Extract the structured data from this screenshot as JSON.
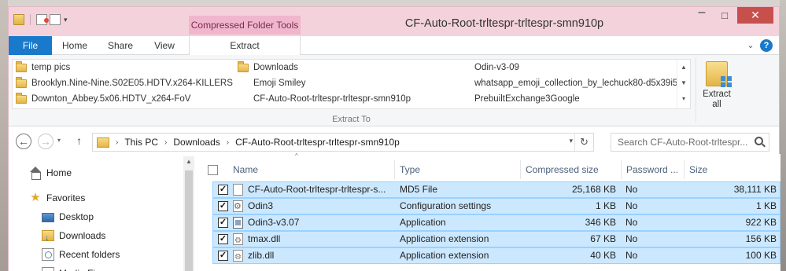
{
  "titlebar": {
    "context_tab_header": "Compressed Folder Tools",
    "window_title": "CF-Auto-Root-trltespr-trltespr-smn910p",
    "minimize": "–",
    "maximize": "□",
    "close": "✕"
  },
  "ribbon_tabs": {
    "file": "File",
    "home": "Home",
    "share": "Share",
    "view": "View",
    "extract": "Extract"
  },
  "extract_to": {
    "group_label": "Extract To",
    "destinations": [
      "temp pics",
      "Brooklyn.Nine-Nine.S02E05.HDTV.x264-KILLERS",
      "Downton_Abbey.5x06.HDTV_x264-FoV",
      "Downloads",
      "Emoji Smiley",
      "CF-Auto-Root-trltespr-trltespr-smn910p",
      "Odin-v3-09",
      "whatsapp_emoji_collection_by_lechuck80-d5x39i5",
      "PrebuiltExchange3Google"
    ],
    "extract_all": "Extract all"
  },
  "address": {
    "crumbs": [
      "This PC",
      "Downloads",
      "CF-Auto-Root-trltespr-trltespr-smn910p"
    ],
    "search_placeholder": "Search CF-Auto-Root-trltespr..."
  },
  "nav_pane": {
    "items": [
      "Home",
      "Favorites",
      "Desktop",
      "Downloads",
      "Recent folders",
      "Media Fi..."
    ]
  },
  "columns": {
    "name": "Name",
    "type": "Type",
    "compressed_size": "Compressed size",
    "password": "Password ...",
    "size": "Size"
  },
  "files": [
    {
      "name": "CF-Auto-Root-trltespr-trltespr-s...",
      "type": "MD5 File",
      "compressed": "25,168 KB",
      "password": "No",
      "size": "38,111 KB",
      "icon": "file-icon"
    },
    {
      "name": "Odin3",
      "type": "Configuration settings",
      "compressed": "1 KB",
      "password": "No",
      "size": "1 KB",
      "icon": "settings-file-icon"
    },
    {
      "name": "Odin3-v3.07",
      "type": "Application",
      "compressed": "346 KB",
      "password": "No",
      "size": "922 KB",
      "icon": "application-icon"
    },
    {
      "name": "tmax.dll",
      "type": "Application extension",
      "compressed": "67 KB",
      "password": "No",
      "size": "156 KB",
      "icon": "dll-icon"
    },
    {
      "name": "zlib.dll",
      "type": "Application extension",
      "compressed": "40 KB",
      "password": "No",
      "size": "100 KB",
      "icon": "dll-icon"
    }
  ]
}
